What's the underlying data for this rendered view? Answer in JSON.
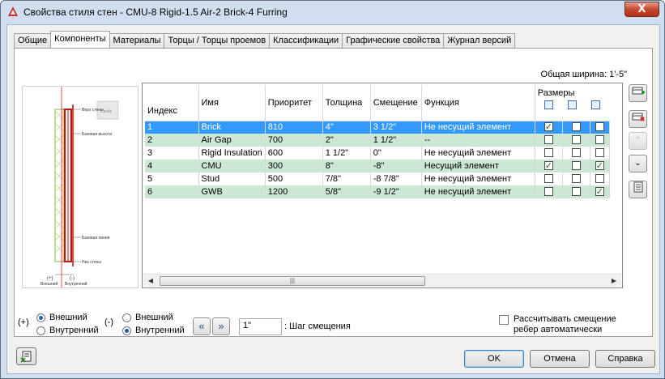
{
  "window": {
    "title": "Свойства стиля стен - CMU-8 Rigid-1.5 Air-2 Brick-4 Furring",
    "close_label": "X"
  },
  "tabs": [
    {
      "label": "Общие"
    },
    {
      "label": "Компоненты"
    },
    {
      "label": "Материалы"
    },
    {
      "label": "Торцы / Торцы проемов"
    },
    {
      "label": "Классификации"
    },
    {
      "label": "Графические свойства"
    },
    {
      "label": "Журнал версий"
    }
  ],
  "total_width_label": "Общая ширина: 1'-5\"",
  "preview": {
    "labels": {
      "top": "Верх стены",
      "base_height": "Базовая высота",
      "base_line": "Базовая линия",
      "bottom": "Низ стены",
      "exterior": "Внешний",
      "interior": "Внутренний",
      "plus": "(+)",
      "minus": "(-)",
      "thumb": "Свойс"
    }
  },
  "grid": {
    "headers": {
      "index": "Индекс",
      "name": "Имя",
      "priority": "Приоритет",
      "thickness": "Толщина",
      "offset": "Смещение",
      "function": "Функция",
      "dimensions": "Размеры"
    },
    "rows": [
      {
        "index": "1",
        "name": "Brick",
        "priority": "810",
        "thickness": "4\"",
        "offset": "3 1/2\"",
        "function": "Не несущий элемент",
        "c1": true,
        "c2": false,
        "c3": false
      },
      {
        "index": "2",
        "name": "Air Gap",
        "priority": "700",
        "thickness": "2\"",
        "offset": "1 1/2\"",
        "function": "--",
        "c1": false,
        "c2": false,
        "c3": false
      },
      {
        "index": "3",
        "name": "Rigid Insulation",
        "priority": "600",
        "thickness": "1 1/2\"",
        "offset": "0\"",
        "function": "Не несущий элемент",
        "c1": false,
        "c2": false,
        "c3": false
      },
      {
        "index": "4",
        "name": "CMU",
        "priority": "300",
        "thickness": "8\"",
        "offset": "-8\"",
        "function": "Несущий элемент",
        "c1": true,
        "c2": false,
        "c3": true
      },
      {
        "index": "5",
        "name": "Stud",
        "priority": "500",
        "thickness": "7/8\"",
        "offset": "-8 7/8\"",
        "function": "Не несущий элемент",
        "c1": false,
        "c2": false,
        "c3": false
      },
      {
        "index": "6",
        "name": "GWB",
        "priority": "1200",
        "thickness": "5/8\"",
        "offset": "-9 1/2\"",
        "function": "Не несущий элемент",
        "c1": false,
        "c2": false,
        "c3": true
      }
    ],
    "scroll_grip": "|||"
  },
  "side_buttons": [
    {
      "icon": "add-component-icon"
    },
    {
      "icon": "delete-component-icon"
    },
    {
      "icon": "move-up-icon"
    },
    {
      "icon": "move-down-icon"
    },
    {
      "icon": "style-browser-icon"
    }
  ],
  "controls": {
    "plus": "(+)",
    "minus": "(-)",
    "exterior": "Внешний",
    "interior": "Внутренний",
    "step_value": "1\"",
    "step_label": ": Шаг смещения",
    "auto_offset_line1": "Рассчитывать смещение",
    "auto_offset_line2": "ребер автоматически"
  },
  "buttons": {
    "ok": "OK",
    "cancel": "Отмена",
    "help": "Справка"
  }
}
